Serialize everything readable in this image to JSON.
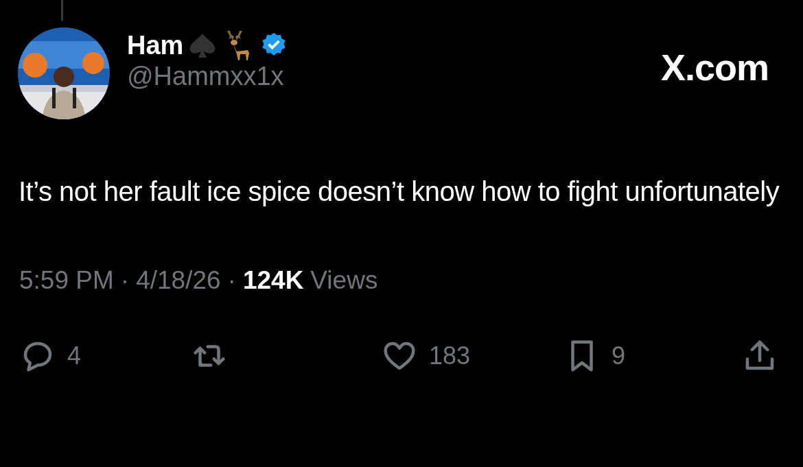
{
  "tweet": {
    "author": {
      "name": "Ham",
      "handle": "@Hammxx1x",
      "verified": true
    },
    "brand": "X.com",
    "text": "It’s not her fault ice spice doesn’t know how to fight unfortunately",
    "meta": [
      {
        "kind": "time",
        "text": "5:59 PM"
      },
      {
        "kind": "separator",
        "text": "·"
      },
      {
        "kind": "date",
        "text": "4/18/26"
      },
      {
        "kind": "separator",
        "text": "·"
      },
      {
        "kind": "views_count",
        "text": "124K"
      },
      {
        "kind": "views_label",
        "text": "Views"
      }
    ],
    "actions": [
      {
        "kind": "reply",
        "count": "4"
      },
      {
        "kind": "repost"
      },
      {
        "kind": "like",
        "count": "183"
      },
      {
        "kind": "bookmark",
        "count": "9"
      },
      {
        "kind": "share"
      }
    ]
  }
}
